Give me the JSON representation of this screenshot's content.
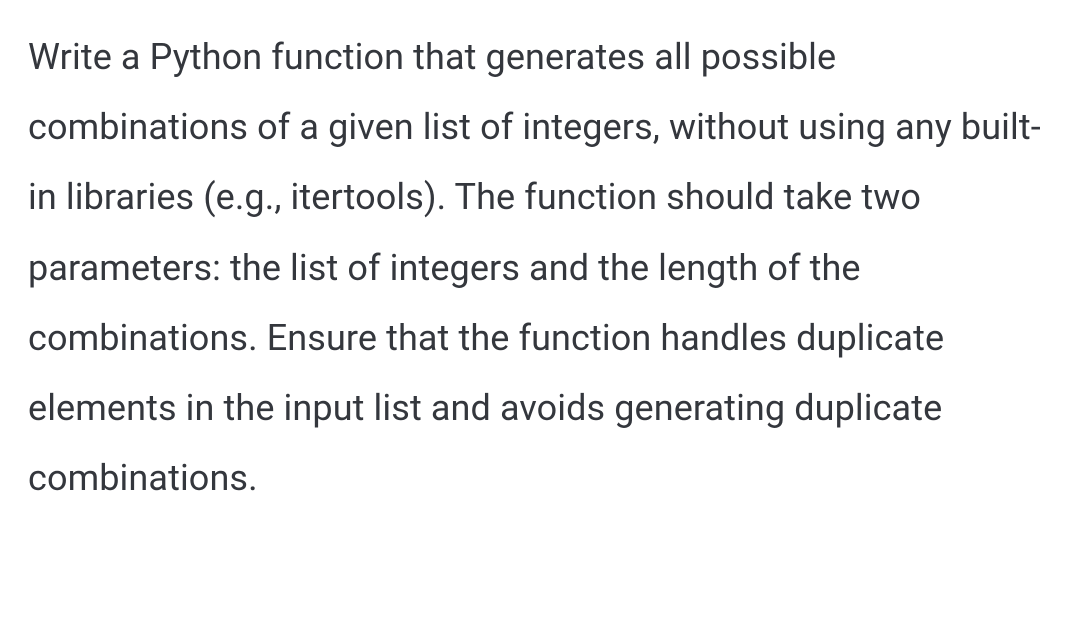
{
  "paragraph": "Write a Python function that generates all possible combinations of a given list of integers, without using any built-in libraries (e.g., itertools). The function should take two parameters: the list of integers and the length of the combinations. Ensure that the function handles duplicate elements in the input list and avoids generating duplicate combinations."
}
